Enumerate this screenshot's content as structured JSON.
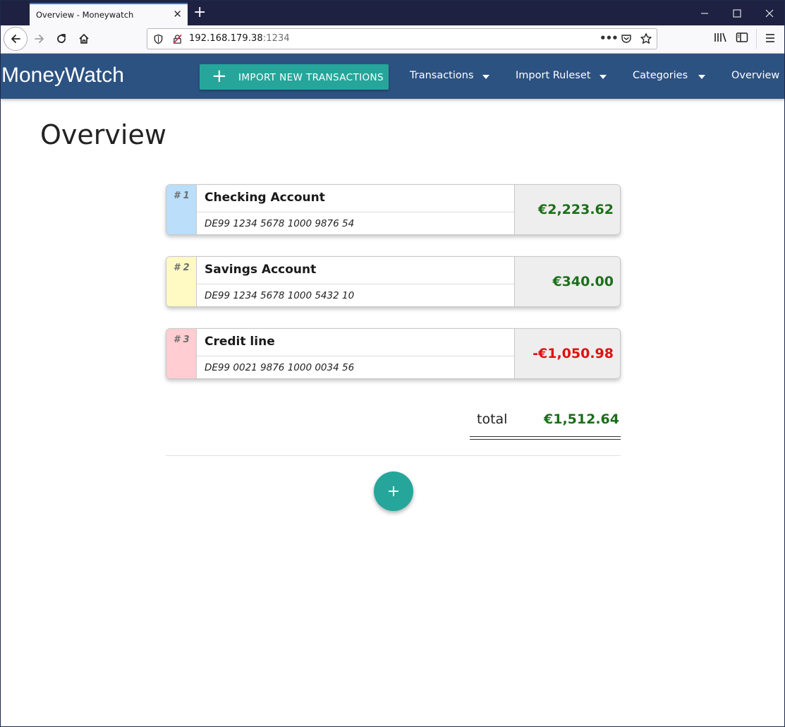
{
  "browser": {
    "tab_title": "Overview - Moneywatch",
    "url_host": "192.168.179.38",
    "url_port": ":1234",
    "url_more": "•••"
  },
  "app": {
    "brand": "MoneyWatch",
    "import_button_label": "IMPORT NEW TRANSACTIONS",
    "import_button_icon": "+",
    "nav": [
      {
        "label": "Transactions",
        "has_dropdown": true
      },
      {
        "label": "Import Ruleset",
        "has_dropdown": true
      },
      {
        "label": "Categories",
        "has_dropdown": true
      },
      {
        "label": "Overview",
        "has_dropdown": false
      }
    ],
    "header_color": "#2c5282",
    "accent_color": "#26a69a"
  },
  "page": {
    "title": "Overview"
  },
  "accounts": [
    {
      "number": "# 1",
      "name": "Checking Account",
      "iban": "DE99 1234 5678 1000 9876 54",
      "balance": "€2,223.62",
      "tag_color": "#bbdefb",
      "balance_color": "#1b6e1b"
    },
    {
      "number": "# 2",
      "name": "Savings Account",
      "iban": "DE99 1234 5678 1000 5432 10",
      "balance": "€340.00",
      "tag_color": "#fff9c4",
      "balance_color": "#1b6e1b"
    },
    {
      "number": "# 3",
      "name": "Credit line",
      "iban": "DE99 0021 9876 1000 0034 56",
      "balance": "-€1,050.98",
      "tag_color": "#ffcdd2",
      "balance_color": "#e01010"
    }
  ],
  "total": {
    "label": "total",
    "value": "€1,512.64",
    "color": "#1b6e1b"
  },
  "add_button_icon": "plus-icon"
}
